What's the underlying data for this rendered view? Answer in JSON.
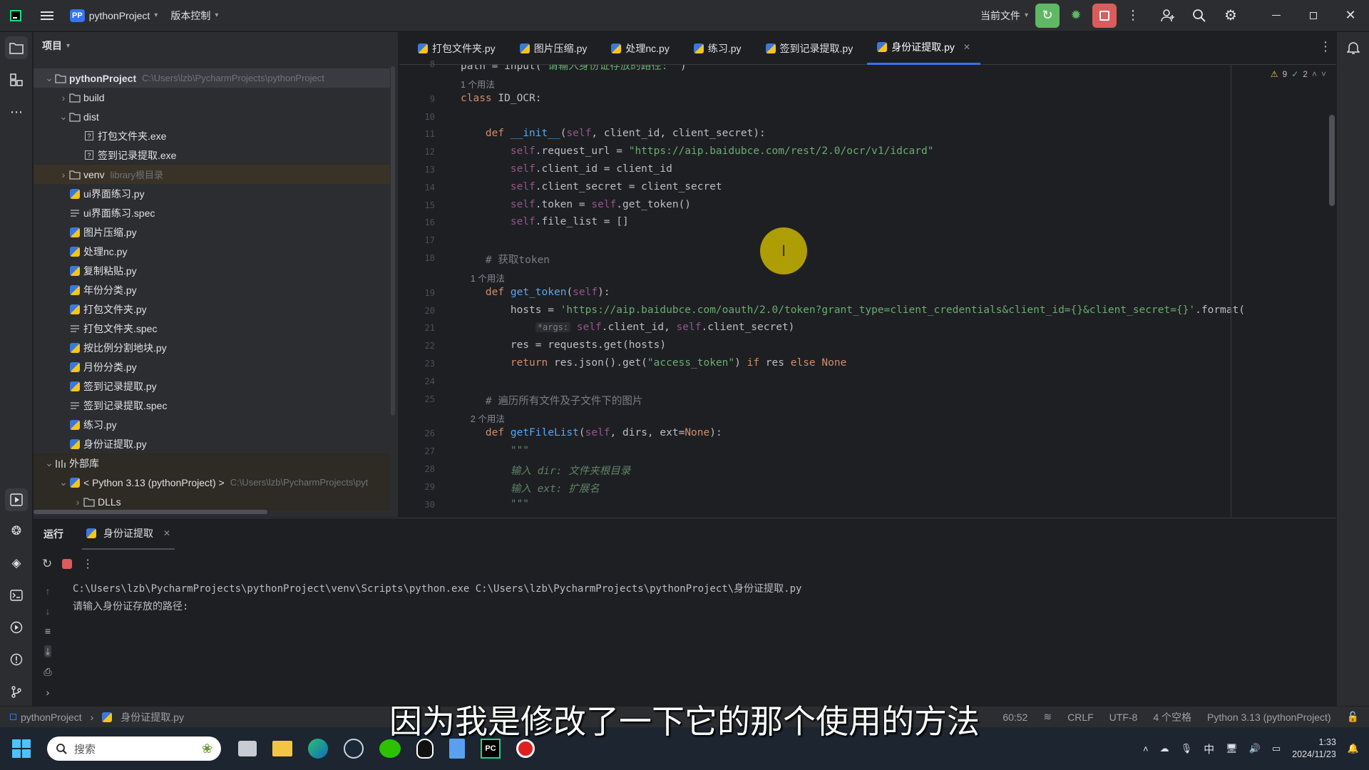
{
  "titlebar": {
    "project_badge": "PP",
    "project_name": "pythonProject",
    "vcs_label": "版本控制",
    "run_config": "当前文件"
  },
  "left_strip": {
    "icons": [
      "folder-icon",
      "structure-icon",
      "more-icon",
      "run-icon",
      "python-console-icon",
      "layers-icon",
      "terminal-icon",
      "services-icon",
      "problems-icon",
      "git-icon"
    ]
  },
  "project_panel": {
    "title": "项目",
    "tree": [
      {
        "label": "pythonProject",
        "hint": "C:\\Users\\lzb\\PycharmProjects\\pythonProject",
        "type": "folder",
        "expanded": true,
        "level": 0
      },
      {
        "label": "build",
        "type": "folder",
        "expanded": false,
        "level": 1
      },
      {
        "label": "dist",
        "type": "folder",
        "expanded": true,
        "level": 1
      },
      {
        "label": "打包文件夹.exe",
        "type": "exe",
        "level": 2
      },
      {
        "label": "签到记录提取.exe",
        "type": "exe",
        "level": 2
      },
      {
        "label": "venv",
        "hint": "library根目录",
        "type": "folder",
        "expanded": false,
        "level": 1
      },
      {
        "label": "ui界面练习.py",
        "type": "py",
        "level": 1
      },
      {
        "label": "ui界面练习.spec",
        "type": "spec",
        "level": 1
      },
      {
        "label": "图片压缩.py",
        "type": "py",
        "level": 1
      },
      {
        "label": "处理nc.py",
        "type": "py",
        "level": 1
      },
      {
        "label": "复制粘贴.py",
        "type": "py",
        "level": 1
      },
      {
        "label": "年份分类.py",
        "type": "py",
        "level": 1
      },
      {
        "label": "打包文件夹.py",
        "type": "py",
        "level": 1
      },
      {
        "label": "打包文件夹.spec",
        "type": "spec",
        "level": 1
      },
      {
        "label": "按比例分割地块.py",
        "type": "py",
        "level": 1
      },
      {
        "label": "月份分类.py",
        "type": "py",
        "level": 1
      },
      {
        "label": "签到记录提取.py",
        "type": "py",
        "level": 1
      },
      {
        "label": "签到记录提取.spec",
        "type": "spec",
        "level": 1
      },
      {
        "label": "练习.py",
        "type": "py",
        "level": 1
      },
      {
        "label": "身份证提取.py",
        "type": "py",
        "level": 1
      },
      {
        "label": "外部库",
        "type": "lib",
        "expanded": true,
        "level": 0
      },
      {
        "label": "< Python 3.13 (pythonProject) >",
        "hint": "C:\\Users\\lzb\\PycharmProjects\\pyt",
        "type": "py",
        "expanded": true,
        "level": 1
      },
      {
        "label": "DLLs",
        "type": "folder",
        "expanded": false,
        "level": 2
      }
    ]
  },
  "editor": {
    "tabs": [
      "打包文件夹.py",
      "图片压缩.py",
      "处理nc.py",
      "练习.py",
      "签到记录提取.py",
      "身份证提取.py"
    ],
    "active_tab": "身份证提取.py",
    "inspection": {
      "warnings": "9",
      "ok": "2"
    },
    "lines": [
      {
        "no": "8",
        "html": "path = input(\"请输入身份证存放的路径: \")"
      },
      {
        "hint": "1 个用法"
      },
      {
        "no": "9",
        "html": "class ID_OCR:"
      },
      {
        "no": "10",
        "html": ""
      },
      {
        "no": "11",
        "html": "    def __init__(self, client_id, client_secret):"
      },
      {
        "no": "12",
        "html": "        self.request_url = \"https://aip.baidubce.com/rest/2.0/ocr/v1/idcard\""
      },
      {
        "no": "13",
        "html": "        self.client_id = client_id"
      },
      {
        "no": "14",
        "html": "        self.client_secret = client_secret"
      },
      {
        "no": "15",
        "html": "        self.token = self.get_token()"
      },
      {
        "no": "16",
        "html": "        self.file_list = []"
      },
      {
        "no": "17",
        "html": ""
      },
      {
        "no": "18",
        "html": "    # 获取token"
      },
      {
        "hint": "    1 个用法"
      },
      {
        "no": "19",
        "html": "    def get_token(self):"
      },
      {
        "no": "20",
        "html": "        hosts = 'https://aip.baidubce.com/oauth/2.0/token?grant_type=client_credentials&client_id={}&client_secret={}'.format("
      },
      {
        "no": "21",
        "html": "            *args: self.client_id, self.client_secret)"
      },
      {
        "no": "22",
        "html": "        res = requests.get(hosts)"
      },
      {
        "no": "23",
        "html": "        return res.json().get(\"access_token\") if res else None"
      },
      {
        "no": "24",
        "html": ""
      },
      {
        "no": "25",
        "html": "    # 遍历所有文件及子文件下的图片"
      },
      {
        "hint": "    2 个用法"
      },
      {
        "no": "26",
        "html": "    def getFileList(self, dirs, ext=None):"
      },
      {
        "no": "27",
        "html": "        \"\"\""
      },
      {
        "no": "28",
        "html": "        输入 dir: 文件夹根目录"
      },
      {
        "no": "29",
        "html": "        输入 ext: 扩展名"
      },
      {
        "no": "30",
        "html": "        \"\"\""
      }
    ]
  },
  "run_panel": {
    "title": "运行",
    "tab": "身份证提取",
    "output": [
      "C:\\Users\\lzb\\PycharmProjects\\pythonProject\\venv\\Scripts\\python.exe C:\\Users\\lzb\\PycharmProjects\\pythonProject\\身份证提取.py",
      "请输入身份证存放的路径:"
    ]
  },
  "statusbar": {
    "breadcrumb_project": "pythonProject",
    "breadcrumb_file": "身份证提取.py",
    "position": "60:52",
    "line_ending": "CRLF",
    "encoding": "UTF-8",
    "indent": "4 个空格",
    "interpreter": "Python 3.13 (pythonProject)"
  },
  "taskbar": {
    "search_placeholder": "搜索",
    "ime": "中",
    "time": "1:33",
    "date": "2024/11/23"
  },
  "subtitle": "因为我是修改了一下它的那个使用的方法",
  "colors": {
    "accent": "#3574f0",
    "run_green": "#5fb865",
    "stop_red": "#db5c5c",
    "cursor_highlight": "#c8b400"
  }
}
